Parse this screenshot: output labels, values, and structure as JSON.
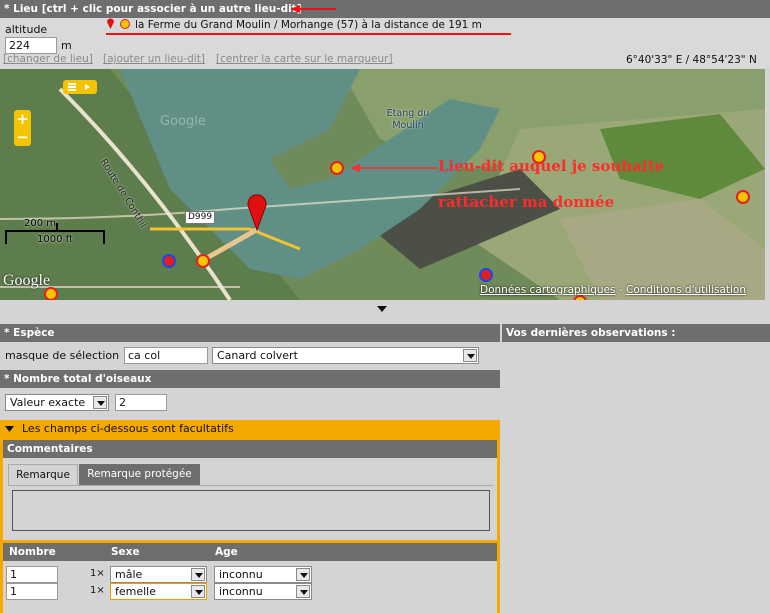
{
  "lieu": {
    "header_label": "* Lieu [ctrl + clic pour associer à un autre lieu-dit]",
    "altitude_label": "altitude",
    "altitude_value": "224",
    "altitude_unit": "m",
    "selected_place": "la Ferme du Grand Moulin / Morhange (57) à la distance de 191 m",
    "links": {
      "change": "[changer de lieu]",
      "add": "[ajouter un lieu-dit]",
      "center": "[centrer la carte sur le marqueur]"
    },
    "coordinates": "6°40'33\" E / 48°54'23\" N"
  },
  "map": {
    "pond_label": "Étang du Moulin",
    "road_label": "Route de Conthil",
    "road_number": "D999",
    "zoom_in": "+",
    "zoom_out": "−",
    "scale_metric": "200 m",
    "scale_imperial": "1000 ft",
    "google_logo": "Google",
    "watermark": "Google",
    "map_data_link": "Données cartographiques",
    "separator": "-",
    "terms_link": "Conditions d'utilisation",
    "annotation_line1": "Lieu-dit auquel je souhaite",
    "annotation_line2": "rattacher ma donnée",
    "colors": {
      "water": "#5f8f85",
      "field": "#7a9460",
      "annotation": "#ff2a2a"
    }
  },
  "espece": {
    "header_label": "* Espèce",
    "mask_label": "masque de sélection",
    "mask_value": "ca col",
    "species_selected": "Canard colvert"
  },
  "nombre_total": {
    "header_label": "* Nombre total d'oiseaux",
    "mode_selected": "Valeur exacte",
    "value": "2"
  },
  "optional": {
    "header_label": "Les champs ci-dessous sont facultatifs",
    "comments_header": "Commentaires",
    "tabs": [
      "Remarque",
      "Remarque protégée"
    ]
  },
  "details": {
    "columns": [
      "Nombre",
      "Sexe",
      "Age"
    ],
    "rows": [
      {
        "nombre": "1",
        "mult": "1×",
        "sexe": "mâle",
        "age": "inconnu"
      },
      {
        "nombre": "1",
        "mult": "1×",
        "sexe": "femelle",
        "age": "inconnu"
      }
    ]
  },
  "recent": {
    "header_label": "Vos dernières observations :"
  }
}
